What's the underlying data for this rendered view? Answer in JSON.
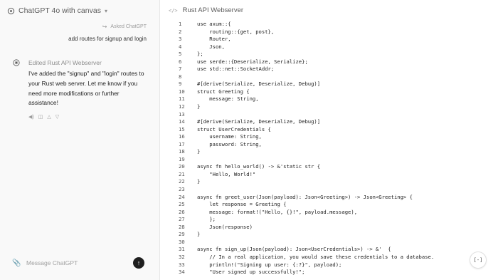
{
  "chat": {
    "model_label": "ChatGPT 4o with canvas",
    "asked_label": "Asked ChatGPT",
    "user_message": "add routes for signup and login",
    "edited_label": "Edited Rust API Webserver",
    "response_text": "I've added the \"signup\" and \"login\" routes to your Rust web server. Let me know if you need more modifications or further assistance!",
    "composer_placeholder": "Message ChatGPT",
    "icons": {
      "model": "chatgpt-logo-icon",
      "asked": "reply-arrow-icon",
      "avatar": "chatgpt-avatar-icon",
      "actions": [
        "speaker-icon",
        "copy-icon",
        "thumbs-up-icon",
        "thumbs-down-icon"
      ],
      "attach": "paperclip-icon",
      "send": "arrow-up-icon"
    }
  },
  "canvas": {
    "title": "Rust API Webserver",
    "title_icon": "</>",
    "fab_label": "[-]",
    "code_lines": [
      {
        "n": "1",
        "t": "use axum::{"
      },
      {
        "n": "2",
        "t": "    routing::{get, post},"
      },
      {
        "n": "3",
        "t": "    Router,"
      },
      {
        "n": "4",
        "t": "    Json,"
      },
      {
        "n": "5",
        "t": "};"
      },
      {
        "n": "6",
        "t": "use serde::{Deserialize, Serialize};"
      },
      {
        "n": "7",
        "t": "use std::net::SocketAddr;"
      },
      {
        "n": "8",
        "t": ""
      },
      {
        "n": "9",
        "t": "#[derive(Serialize, Deserialize, Debug)]"
      },
      {
        "n": "10",
        "t": "struct Greeting {"
      },
      {
        "n": "11",
        "t": "    message: String,"
      },
      {
        "n": "12",
        "t": "}"
      },
      {
        "n": "13",
        "t": ""
      },
      {
        "n": "14",
        "t": "#[derive(Serialize, Deserialize, Debug)]"
      },
      {
        "n": "15",
        "t": "struct UserCredentials {"
      },
      {
        "n": "16",
        "t": "    username: String,"
      },
      {
        "n": "17",
        "t": "    password: String,"
      },
      {
        "n": "18",
        "t": "}"
      },
      {
        "n": "19",
        "t": ""
      },
      {
        "n": "20",
        "t": "async fn hello_world() -> &'static str {"
      },
      {
        "n": "21",
        "t": "    \"Hello, World!\""
      },
      {
        "n": "22",
        "t": "}"
      },
      {
        "n": "23",
        "t": ""
      },
      {
        "n": "24",
        "t": "async fn greet_user(Json(payload): Json<Greeting>) -> Json<Greeting> {"
      },
      {
        "n": "25",
        "t": "    let response = Greeting {"
      },
      {
        "n": "26",
        "t": "    message: format!(\"Hello, {}!\", payload.message),"
      },
      {
        "n": "27",
        "t": "    };"
      },
      {
        "n": "28",
        "t": "    Json(response)"
      },
      {
        "n": "29",
        "t": "}"
      },
      {
        "n": "30",
        "t": ""
      },
      {
        "n": "31",
        "t": "async fn sign_up(Json(payload): Json<UserCredentials>) -> &'  {"
      },
      {
        "n": "32",
        "t": "    // In a real application, you would save these credentials to a database."
      },
      {
        "n": "33",
        "t": "    println!(\"Signing up user: {:?}\", payload);"
      },
      {
        "n": "34",
        "t": "    \"User signed up successfully!\";"
      }
    ]
  }
}
